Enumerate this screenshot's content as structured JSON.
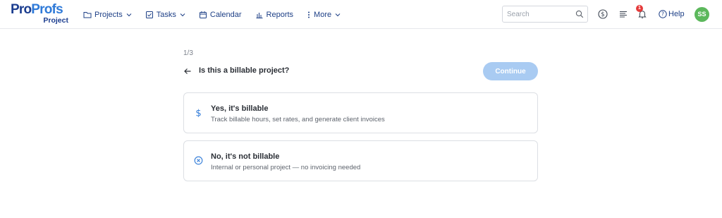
{
  "logo": {
    "main_part1": "Pro",
    "main_part2": "Profs",
    "sub": "Project"
  },
  "nav": [
    {
      "label": "Projects",
      "icon": "folder-icon",
      "dropdown": true
    },
    {
      "label": "Tasks",
      "icon": "checkbox-icon",
      "dropdown": true
    },
    {
      "label": "Calendar",
      "icon": "calendar-icon",
      "dropdown": false
    },
    {
      "label": "Reports",
      "icon": "bar-chart-icon",
      "dropdown": false
    },
    {
      "label": "More",
      "icon": "vertical-dots-icon",
      "dropdown": true
    }
  ],
  "search": {
    "placeholder": "Search",
    "value": ""
  },
  "header": {
    "notification_count": "1",
    "help_label": "Help",
    "avatar_initials": "SS"
  },
  "wizard": {
    "step": "1/3",
    "question": "Is this a billable project?",
    "continue_label": "Continue",
    "options": [
      {
        "title": "Yes, it's billable",
        "description": "Track billable hours, set rates, and generate client invoices",
        "icon": "dollar-icon"
      },
      {
        "title": "No, it's not billable",
        "description": "Internal or personal project — no invoicing needed",
        "icon": "circle-x-icon"
      }
    ]
  },
  "colors": {
    "brand_dark": "#1b3d8f",
    "brand_light": "#2f7ad8",
    "button_disabled": "#a9cbf2",
    "badge_red": "#e53a3a",
    "avatar_green": "#5cb85c"
  }
}
